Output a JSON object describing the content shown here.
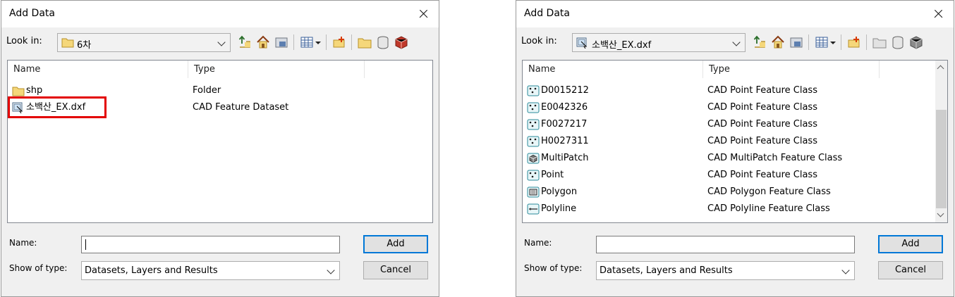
{
  "left_dialog": {
    "title": "Add Data",
    "look_in_label": "Look in:",
    "look_in_value": "6차",
    "columns": [
      "Name",
      "Type"
    ],
    "items": [
      {
        "name": "shp",
        "type": "Folder",
        "icon": "folder-icon"
      },
      {
        "name": "소백산_EX.dxf",
        "type": "CAD Feature Dataset",
        "icon": "cad-dataset-icon",
        "highlighted": true
      }
    ],
    "name_label": "Name:",
    "name_value": "",
    "show_type_label": "Show of type:",
    "show_type_value": "Datasets, Layers and Results",
    "add_button": "Add",
    "cancel_button": "Cancel"
  },
  "right_dialog": {
    "title": "Add Data",
    "look_in_label": "Look in:",
    "look_in_value": "소백산_EX.dxf",
    "columns": [
      "Name",
      "Type"
    ],
    "items": [
      {
        "name": "D0015212",
        "type": "CAD Point Feature Class",
        "icon": "cad-point-icon"
      },
      {
        "name": "E0042326",
        "type": "CAD Point Feature Class",
        "icon": "cad-point-icon"
      },
      {
        "name": "F0027217",
        "type": "CAD Point Feature Class",
        "icon": "cad-point-icon"
      },
      {
        "name": "H0027311",
        "type": "CAD Point Feature Class",
        "icon": "cad-point-icon"
      },
      {
        "name": "MultiPatch",
        "type": "CAD MultiPatch Feature Class",
        "icon": "cad-multipatch-icon"
      },
      {
        "name": "Point",
        "type": "CAD Point Feature Class",
        "icon": "cad-point-icon"
      },
      {
        "name": "Polygon",
        "type": "CAD Polygon Feature Class",
        "icon": "cad-polygon-icon"
      },
      {
        "name": "Polyline",
        "type": "CAD Polyline Feature Class",
        "icon": "cad-polyline-icon"
      }
    ],
    "name_label": "Name:",
    "name_value": "",
    "show_type_label": "Show of type:",
    "show_type_value": "Datasets, Layers and Results",
    "add_button": "Add",
    "cancel_button": "Cancel"
  },
  "colors": {
    "highlight": "#e30000",
    "default_button_border": "#0078d7",
    "dialog_background": "#f0f0f0"
  }
}
